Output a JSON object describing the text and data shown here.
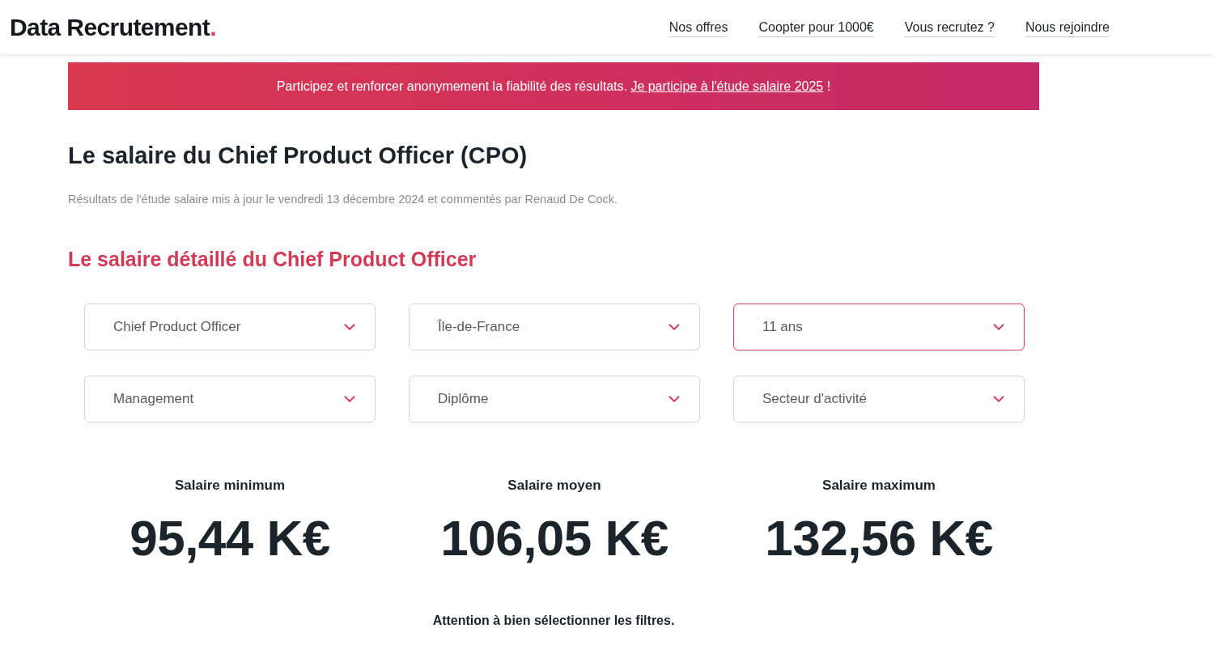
{
  "header": {
    "logo": {
      "text": "Data Recrutement",
      "dot": "."
    },
    "nav": [
      {
        "label": "Nos offres"
      },
      {
        "label": "Coopter pour 1000€"
      },
      {
        "label": "Vous recrutez ?"
      },
      {
        "label": "Nous rejoindre"
      }
    ]
  },
  "banner": {
    "text": "Participez et renforcer anonymement la fiabilité des résultats.",
    "link": "Je participe à l'étude salaire 2025",
    "suffix": "!"
  },
  "page": {
    "title": "Le salaire du Chief Product Officer (CPO)",
    "subtitle": "Résultats de l'étude salaire mis à jour le vendredi 13 décembre 2024 et commentés par Renaud De Cock."
  },
  "section": {
    "title": "Le salaire détaillé du Chief Product Officer",
    "filters": [
      {
        "value": "Chief Product Officer",
        "highlighted": false
      },
      {
        "value": "Île-de-France",
        "highlighted": false
      },
      {
        "value": "11 ans",
        "highlighted": true
      },
      {
        "value": "Management",
        "highlighted": false
      },
      {
        "value": "Diplôme",
        "highlighted": false
      },
      {
        "value": "Secteur d'activité",
        "highlighted": false
      }
    ],
    "stats": [
      {
        "label": "Salaire minimum",
        "value": "95,44 K€"
      },
      {
        "label": "Salaire moyen",
        "value": "106,05 K€"
      },
      {
        "label": "Salaire maximum",
        "value": "132,56 K€"
      }
    ],
    "note": "Attention à bien sélectionner les filtres."
  }
}
